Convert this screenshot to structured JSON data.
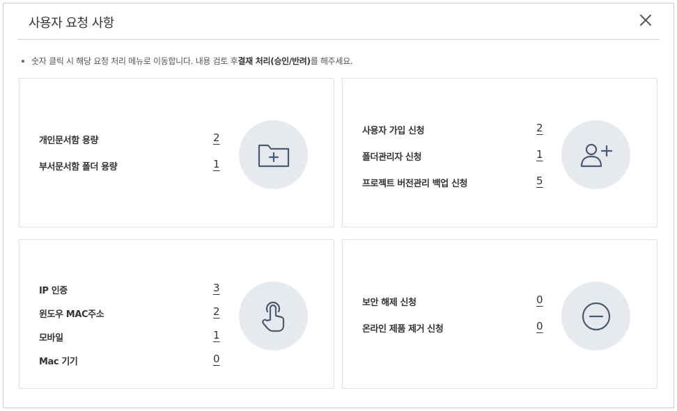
{
  "dialog": {
    "title": "사용자 요청 사항",
    "close_icon": "close-icon"
  },
  "notice": {
    "text_before": "숫자 클릭 시 해당 요청 처리 메뉴로 이동합니다. 내용 검토 후 ",
    "text_bold": "결재 처리(승인/반려)",
    "text_after": "를 해주세요."
  },
  "cards": {
    "mailbox": {
      "icon": "folder-plus-icon",
      "items": [
        {
          "label": "개인문서함 용량",
          "count": "2"
        },
        {
          "label": "부서문서함 폴더 용량",
          "count": "1"
        }
      ]
    },
    "user": {
      "icon": "user-plus-icon",
      "items": [
        {
          "label": "사용자 가입 신청",
          "count": "2"
        },
        {
          "label": "폴더관리자 신청",
          "count": "1"
        },
        {
          "label": "프로젝트 버전관리 백업 신청",
          "count": "5"
        }
      ]
    },
    "access": {
      "icon": "hand-pointer-icon",
      "items": [
        {
          "label": "IP 인증",
          "count": "3"
        },
        {
          "label": "윈도우 MAC주소",
          "count": "2"
        },
        {
          "label": "모바일",
          "count": "1"
        },
        {
          "label": "Mac 기기",
          "count": "0"
        }
      ]
    },
    "security": {
      "icon": "minus-circle-icon",
      "items": [
        {
          "label": "보안 해제 신청",
          "count": "0"
        },
        {
          "label": "온라인 제품 제거 신청",
          "count": "0"
        }
      ]
    }
  },
  "colors": {
    "icon_stroke": "#4a5a70",
    "icon_bg": "#e6e9ee",
    "border": "#dde0e4"
  }
}
